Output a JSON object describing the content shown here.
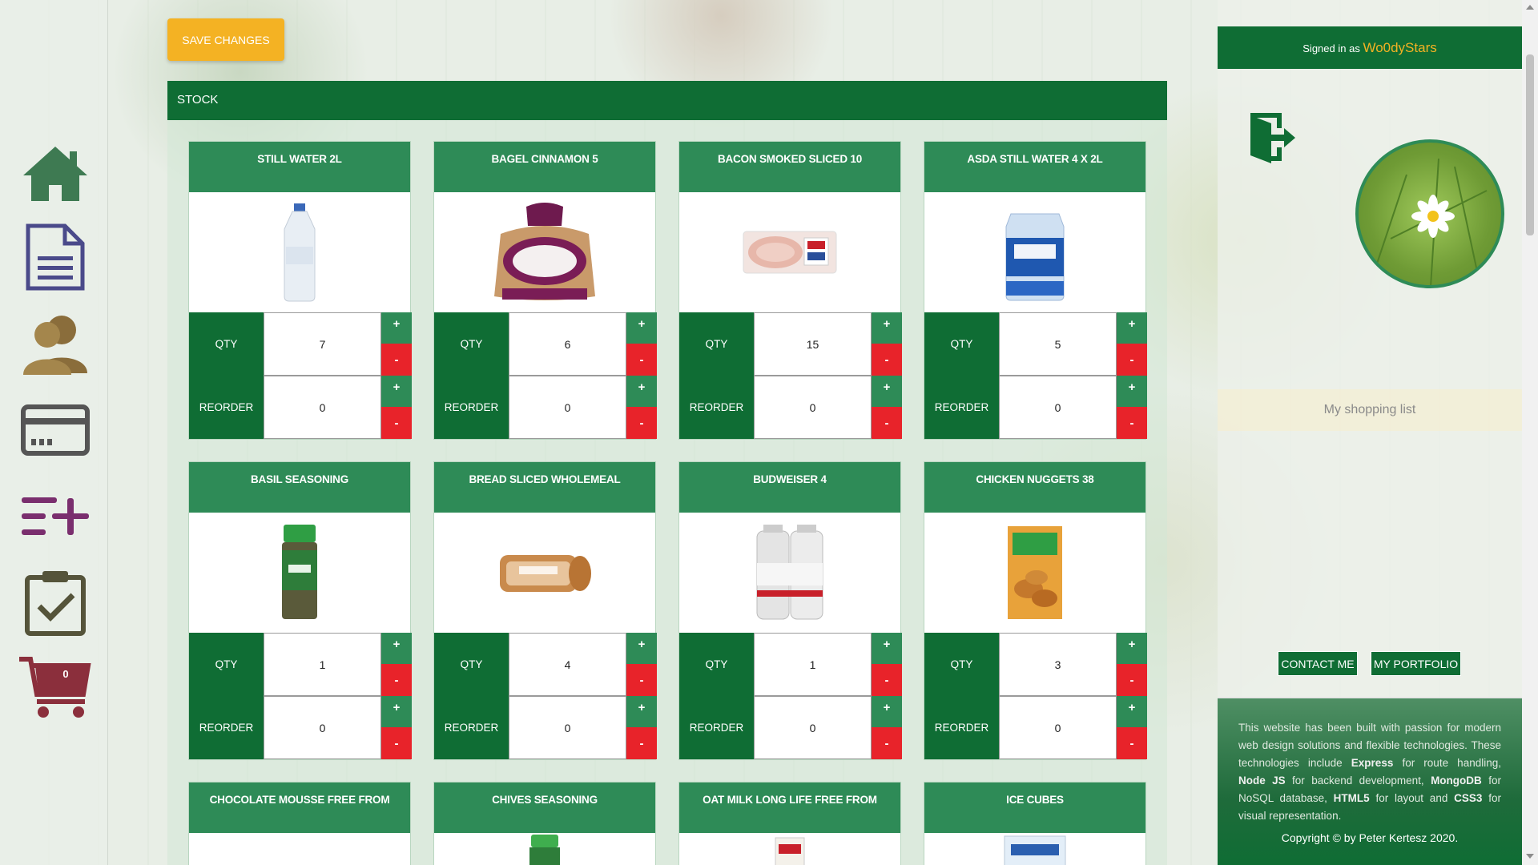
{
  "header": {
    "save_label": "SAVE CHANGES",
    "stock_title": "STOCK"
  },
  "nav": {
    "items": [
      "home-icon",
      "document-icon",
      "user-icon",
      "credit-card-icon",
      "add-list-icon",
      "clipboard-check-icon",
      "cart-icon"
    ],
    "cart_count": "0"
  },
  "labels": {
    "qty": "QTY",
    "reorder": "REORDER",
    "plus": "+",
    "minus": "-"
  },
  "products": [
    {
      "name": "STILL WATER 2L",
      "qty": "7",
      "reorder": "0"
    },
    {
      "name": "BAGEL CINNAMON 5",
      "qty": "6",
      "reorder": "0"
    },
    {
      "name": "BACON SMOKED SLICED 10",
      "qty": "15",
      "reorder": "0"
    },
    {
      "name": "ASDA STILL WATER 4 X 2L",
      "qty": "5",
      "reorder": "0"
    },
    {
      "name": "BASIL SEASONING",
      "qty": "1",
      "reorder": "0"
    },
    {
      "name": "BREAD SLICED WHOLEMEAL",
      "qty": "4",
      "reorder": "0"
    },
    {
      "name": "BUDWEISER 4",
      "qty": "1",
      "reorder": "0"
    },
    {
      "name": "CHICKEN NUGGETS 38",
      "qty": "3",
      "reorder": "0"
    },
    {
      "name": "CHOCOLATE MOUSSE FREE FROM"
    },
    {
      "name": "CHIVES SEASONING"
    },
    {
      "name": "OAT MILK LONG LIFE FREE FROM"
    },
    {
      "name": "ICE CUBES"
    }
  ],
  "sidebar": {
    "signed_prefix": "Signed in as",
    "username": "Wo0dyStars",
    "shopping_list": "My shopping list",
    "contact_label": "CONTACT ME",
    "portfolio_label": "MY PORTFOLIO",
    "footer_1": "This website has been built with passion for modern web design solutions and flexible technologies. These technologies include",
    "footer_express": "Express",
    "footer_2": "for route handling,",
    "footer_node": "Node JS",
    "footer_3": "for backend development,",
    "footer_mongo": "MongoDB",
    "footer_4": "for NoSQL database,",
    "footer_html": "HTML5",
    "footer_5": "for layout and",
    "footer_css": "CSS3",
    "footer_6": "for visual representation.",
    "copyright": "Copyright © by Peter Kertesz 2020."
  },
  "colors": {
    "primary_green": "#0f6d34",
    "card_green": "#2e8b57",
    "accent": "#f4b223",
    "minus_red": "#e8232a"
  }
}
